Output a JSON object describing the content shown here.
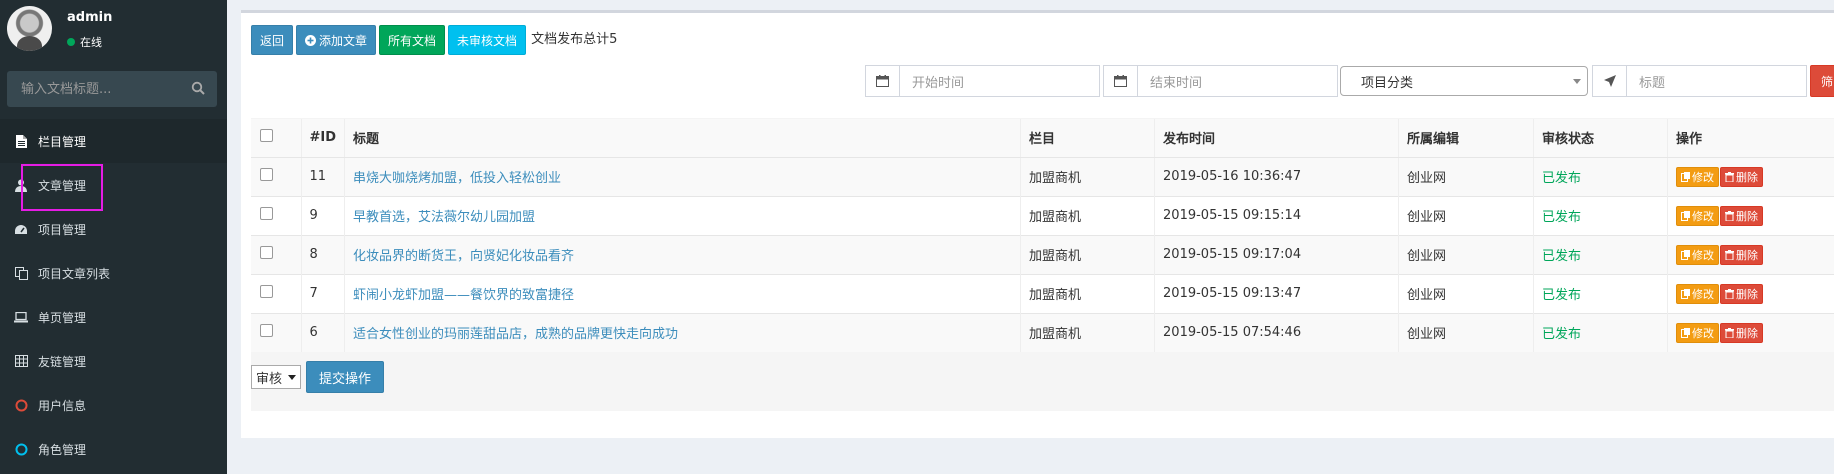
{
  "user": {
    "name": "admin",
    "status": "在线"
  },
  "search": {
    "placeholder": "输入文档标题..."
  },
  "sidebar": {
    "items": [
      {
        "label": "栏目管理",
        "icon": "file-icon"
      },
      {
        "label": "文章管理",
        "icon": "user-secret-icon"
      },
      {
        "label": "项目管理",
        "icon": "dashboard-icon"
      },
      {
        "label": "项目文章列表",
        "icon": "copy-icon"
      },
      {
        "label": "单页管理",
        "icon": "laptop-icon"
      },
      {
        "label": "友链管理",
        "icon": "table-icon"
      },
      {
        "label": "用户信息",
        "icon": "circle-icon"
      },
      {
        "label": "角色管理",
        "icon": "circle-icon"
      }
    ]
  },
  "toolbar": {
    "back": "返回",
    "add": "添加文章",
    "all": "所有文档",
    "unreviewed": "未审核文档",
    "total_text": "文档发布总计5"
  },
  "filters": {
    "start_placeholder": "开始时间",
    "end_placeholder": "结束时间",
    "category_selected": "项目分类",
    "title_placeholder": "标题",
    "filter_button": "筛"
  },
  "table": {
    "headers": [
      "#ID",
      "标题",
      "栏目",
      "发布时间",
      "所属编辑",
      "审核状态",
      "操作"
    ],
    "rows": [
      {
        "id": "11",
        "title": "串烧大咖烧烤加盟，低投入轻松创业",
        "category": "加盟商机",
        "time": "2019-05-16 10:36:47",
        "editor": "创业网",
        "status": "已发布"
      },
      {
        "id": "9",
        "title": "早教首选，艾法薇尔幼儿园加盟",
        "category": "加盟商机",
        "time": "2019-05-15 09:15:14",
        "editor": "创业网",
        "status": "已发布"
      },
      {
        "id": "8",
        "title": "化妆品界的断货王，向贤妃化妆品看齐",
        "category": "加盟商机",
        "time": "2019-05-15 09:17:04",
        "editor": "创业网",
        "status": "已发布"
      },
      {
        "id": "7",
        "title": "虾闹小龙虾加盟——餐饮界的致富捷径",
        "category": "加盟商机",
        "time": "2019-05-15 09:13:47",
        "editor": "创业网",
        "status": "已发布"
      },
      {
        "id": "6",
        "title": "适合女性创业的玛丽莲甜品店，成熟的品牌更快走向成功",
        "category": "加盟商机",
        "time": "2019-05-15 07:54:46",
        "editor": "创业网",
        "status": "已发布"
      }
    ],
    "edit_label": "修改",
    "delete_label": "删除"
  },
  "bottom": {
    "action_selected": "审核",
    "submit": "提交操作"
  },
  "colors": {
    "sidebar_bg": "#222d32",
    "primary": "#3c8dbc",
    "success": "#00a65a",
    "info": "#00c0ef",
    "warning": "#f39c12",
    "danger": "#dd4b39",
    "highlight": "#e51ce5"
  }
}
